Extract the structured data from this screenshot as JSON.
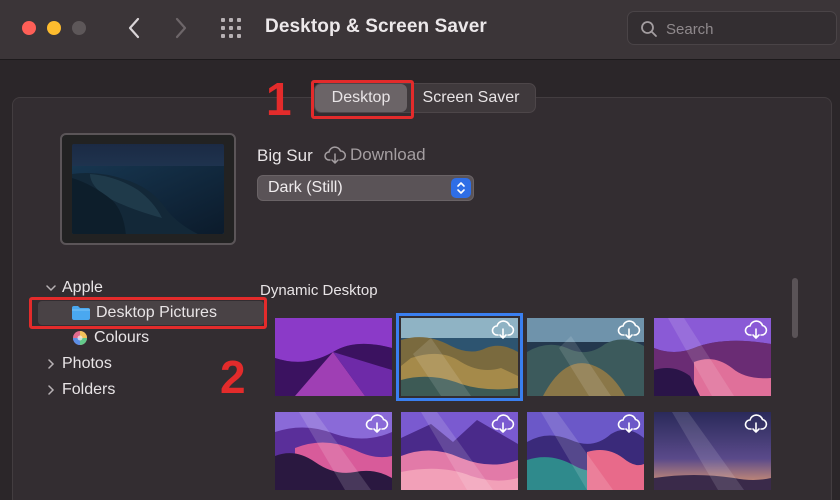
{
  "window": {
    "title": "Desktop & Screen Saver",
    "search_placeholder": "Search"
  },
  "tabs": [
    {
      "label": "Desktop",
      "active": true
    },
    {
      "label": "Screen Saver",
      "active": false
    }
  ],
  "annotations": {
    "one": "1",
    "two": "2",
    "color": "#e32b2b"
  },
  "current_wallpaper": {
    "name": "Big Sur",
    "download_label": "Download",
    "mode_value": "Dark (Still)"
  },
  "sidebar": {
    "items": [
      {
        "label": "Apple",
        "expanded": true
      },
      {
        "label": "Desktop Pictures",
        "selected": true,
        "icon": "folder-icon"
      },
      {
        "label": "Colours",
        "icon": "color-wheel-icon"
      },
      {
        "label": "Photos",
        "expanded": false
      },
      {
        "label": "Folders",
        "expanded": false
      }
    ]
  },
  "gallery": {
    "section_title": "Dynamic Desktop",
    "thumbnails": [
      {
        "name": "monterey-purple",
        "download": false,
        "selected": false
      },
      {
        "name": "catalina-day",
        "download": true,
        "selected": true
      },
      {
        "name": "catalina-island",
        "download": true,
        "selected": false
      },
      {
        "name": "big-sur-coast-pink",
        "download": true,
        "selected": false
      },
      {
        "name": "big-sur-valley",
        "download": true,
        "selected": false
      },
      {
        "name": "big-sur-mountains",
        "download": true,
        "selected": false
      },
      {
        "name": "big-sur-cliffs",
        "download": true,
        "selected": false
      },
      {
        "name": "big-sur-gradient",
        "download": true,
        "selected": false
      }
    ]
  },
  "colors": {
    "accent": "#2f6ee6",
    "selection_outline": "#3a7ff0",
    "folder": "#4aa8f0"
  }
}
